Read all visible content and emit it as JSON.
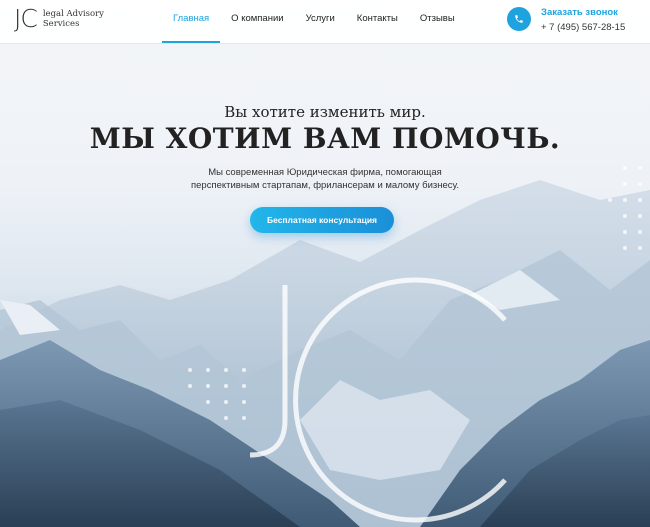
{
  "brand": {
    "mark": "JC",
    "name": "legal Advisory Services"
  },
  "nav": {
    "items": [
      {
        "label": "Главная",
        "active": true
      },
      {
        "label": "О компании",
        "active": false
      },
      {
        "label": "Услуги",
        "active": false
      },
      {
        "label": "Контакты",
        "active": false
      },
      {
        "label": "Отзывы",
        "active": false
      }
    ]
  },
  "callback": {
    "label": "Заказать звонок",
    "phone": "+ 7 (495) 567-28-15",
    "icon": "phone-icon"
  },
  "hero": {
    "subtitle": "Вы хотите изменить мир.",
    "title": "МЫ ХОТИМ ВАМ ПОМОЧЬ.",
    "description": "Мы современная Юридическая фирма, помогающая перспективным стартапам, фрилансерам и малому бизнесу.",
    "cta": "Бесплатная консультация",
    "watermark": "JC"
  },
  "colors": {
    "accent": "#1ea3de",
    "text": "#222222"
  }
}
